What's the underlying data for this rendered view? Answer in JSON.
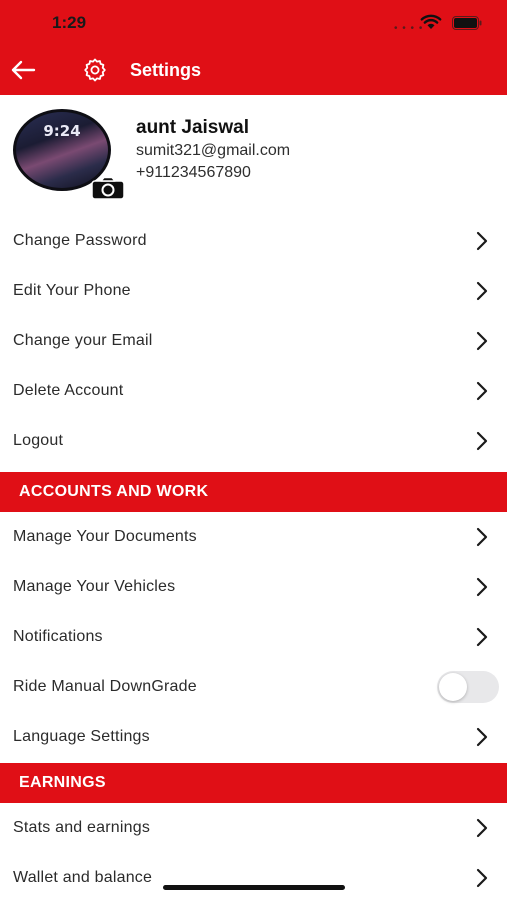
{
  "status_bar": {
    "time": "1:29"
  },
  "header": {
    "title": "Settings"
  },
  "profile": {
    "avatar_time": "9:24",
    "name": "aunt Jaiswal",
    "email": "sumit321@gmail.com",
    "phone": "+911234567890"
  },
  "account_items": [
    {
      "label": "Change Password"
    },
    {
      "label": "Edit Your Phone"
    },
    {
      "label": "Change your Email"
    },
    {
      "label": "Delete Account"
    },
    {
      "label": "Logout"
    }
  ],
  "sections": {
    "accounts_and_work": "ACCOUNTS AND WORK",
    "earnings": "EARNINGS"
  },
  "work_items": [
    {
      "label": "Manage Your Documents"
    },
    {
      "label": "Manage Your Vehicles"
    },
    {
      "label": "Notifications"
    },
    {
      "label": "Ride Manual DownGrade",
      "toggle": false
    },
    {
      "label": "Language Settings"
    }
  ],
  "earnings_items": [
    {
      "label": "Stats and earnings"
    },
    {
      "label": "Wallet and balance"
    }
  ],
  "colors": {
    "accent": "#e00f16"
  }
}
